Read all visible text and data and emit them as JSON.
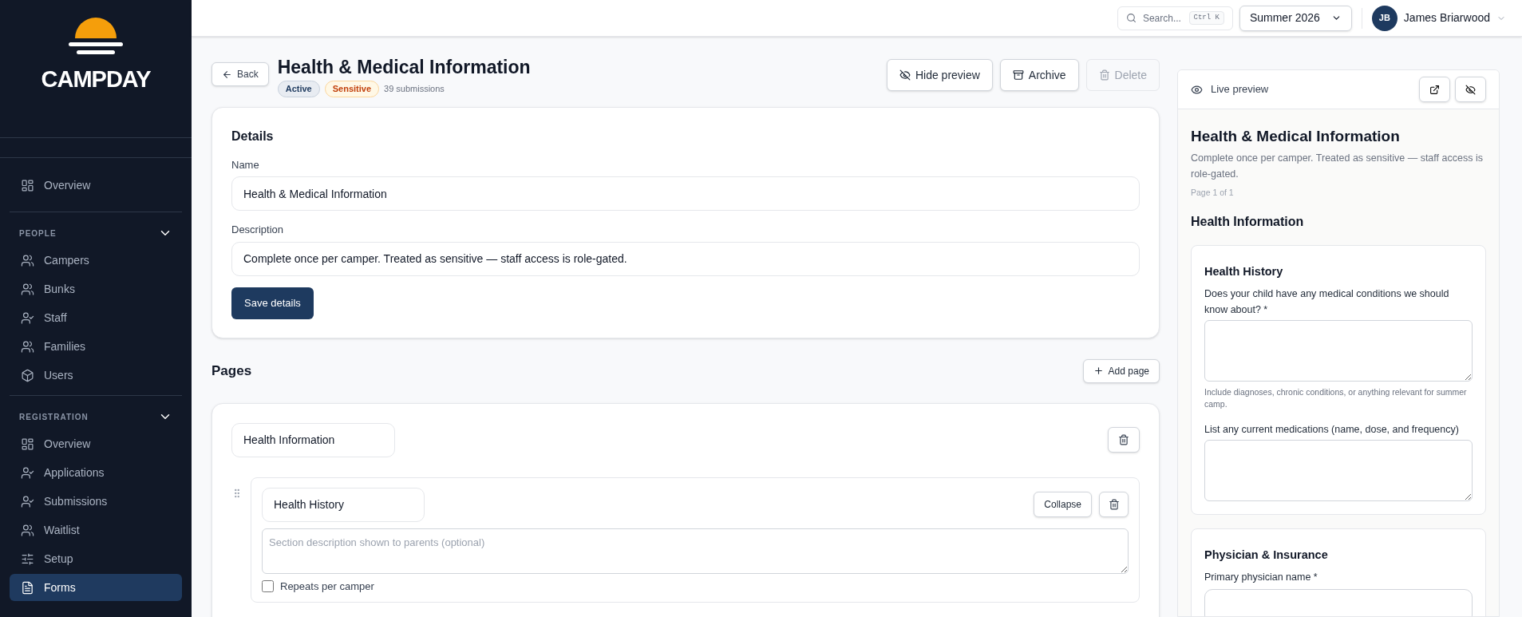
{
  "sidebar": {
    "brand": "CAMPDAY",
    "top_items": [
      {
        "label": "Overview",
        "selected": false
      }
    ],
    "groups": [
      {
        "title": "PEOPLE",
        "expanded": true,
        "items": [
          {
            "label": "Campers",
            "selected": false
          },
          {
            "label": "Bunks",
            "selected": false
          },
          {
            "label": "Staff",
            "selected": false
          },
          {
            "label": "Families",
            "selected": false
          },
          {
            "label": "Users",
            "selected": false
          }
        ]
      },
      {
        "title": "REGISTRATION",
        "expanded": true,
        "items": [
          {
            "label": "Overview",
            "selected": false
          },
          {
            "label": "Applications",
            "selected": false
          },
          {
            "label": "Submissions",
            "selected": false
          },
          {
            "label": "Waitlist",
            "selected": false
          },
          {
            "label": "Setup",
            "selected": false
          },
          {
            "label": "Forms",
            "selected": true
          }
        ]
      }
    ]
  },
  "topbar": {
    "search": {
      "placeholder": "Search...",
      "shortcut": "Ctrl K"
    },
    "season": "Summer 2026",
    "user": {
      "initials": "JB",
      "name": "James Briarwood"
    }
  },
  "header": {
    "back": "Back",
    "title": "Health & Medical Information",
    "badges": [
      {
        "label": "Active",
        "kind": "status"
      },
      {
        "label": "Sensitive",
        "kind": "warning"
      }
    ],
    "meta": "39 submissions",
    "actions": [
      {
        "label": "Hide preview",
        "disabled": false
      },
      {
        "label": "Archive",
        "disabled": false
      },
      {
        "label": "Delete",
        "disabled": true
      }
    ]
  },
  "details": {
    "title": "Details",
    "fields": [
      {
        "label": "Name",
        "value": "Health & Medical Information"
      },
      {
        "label": "Description",
        "value": "Complete once per camper. Treated as sensitive — staff access is role-gated."
      }
    ],
    "save": "Save details"
  },
  "pages": {
    "title": "Pages",
    "add": "Add page",
    "items": [
      {
        "name": "Health Information",
        "sections": [
          {
            "name": "Health History",
            "collapse": "Collapse",
            "description_placeholder": "Section description shown to parents (optional)",
            "repeats": {
              "label": "Repeats per camper",
              "checked": false
            }
          }
        ]
      }
    ]
  },
  "preview": {
    "title": "Live preview",
    "form_title": "Health & Medical Information",
    "description": "Complete once per camper. Treated as sensitive — staff access is role-gated.",
    "page_indicator": "Page 1 of 1",
    "page_title": "Health Information",
    "sections": [
      {
        "title": "Health History",
        "questions": [
          {
            "label": "Does your child have any medical conditions we should know about? *",
            "help": "Include diagnoses, chronic conditions, or anything relevant for summer camp.",
            "kind": "textarea"
          },
          {
            "label": "List any current medications (name, dose, and frequency)",
            "kind": "textarea"
          }
        ]
      },
      {
        "title": "Physician & Insurance",
        "questions": [
          {
            "label": "Primary physician name *",
            "kind": "text"
          }
        ]
      }
    ]
  }
}
